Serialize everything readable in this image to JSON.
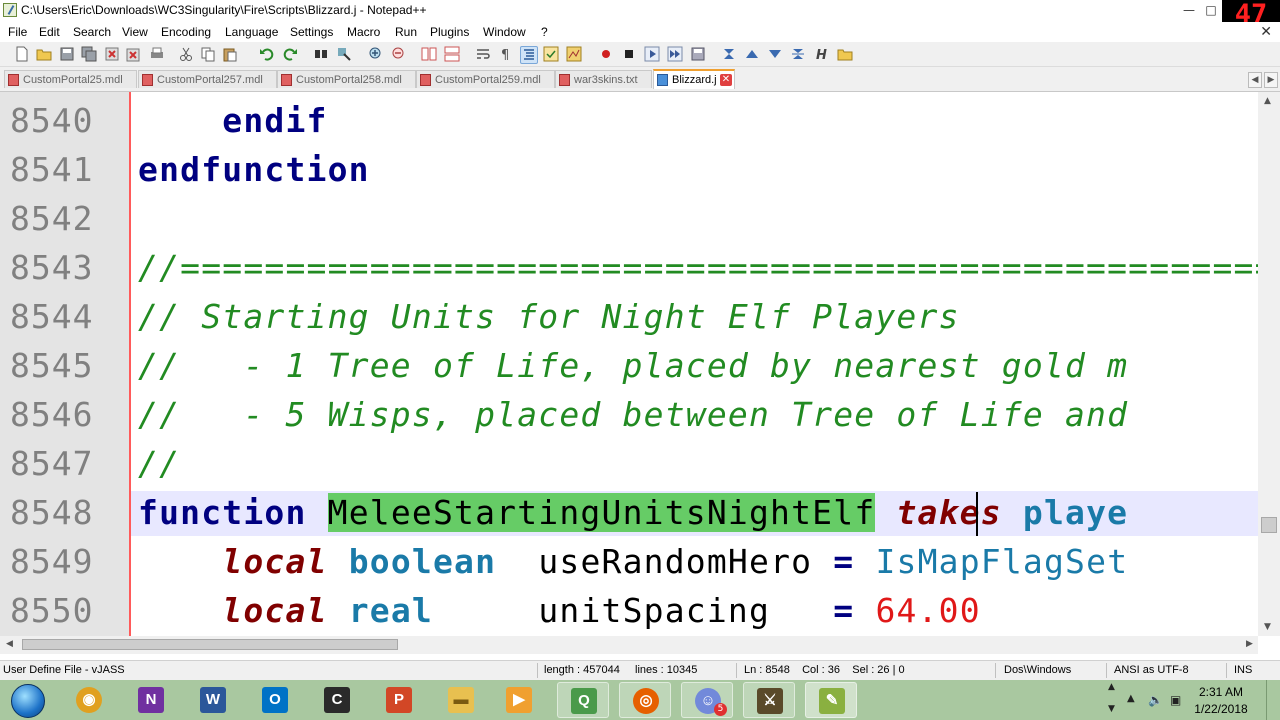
{
  "window": {
    "title": "C:\\Users\\Eric\\Downloads\\WC3Singularity\\Fire\\Scripts\\Blizzard.j - Notepad++",
    "minimize_glyph": "—",
    "maximize_glyph": "□",
    "counter_value": "47"
  },
  "menu": {
    "items": [
      "File",
      "Edit",
      "Search",
      "View",
      "Encoding",
      "Language",
      "Settings",
      "Macro",
      "Run",
      "Plugins",
      "Window",
      "?"
    ],
    "close_glyph": "✕"
  },
  "tabs": [
    {
      "label": "CustomPortal25.mdl",
      "active": false
    },
    {
      "label": "CustomPortal257.mdl",
      "active": false
    },
    {
      "label": "CustomPortal258.mdl",
      "active": false
    },
    {
      "label": "CustomPortal259.mdl",
      "active": false
    },
    {
      "label": "war3skins.txt",
      "active": false
    },
    {
      "label": "Blizzard.j",
      "active": true
    }
  ],
  "tab_close_glyph": "✕",
  "editor": {
    "line_numbers": [
      "8540",
      "8541",
      "8542",
      "8543",
      "8544",
      "8545",
      "8546",
      "8547",
      "8548",
      "8549",
      "8550"
    ],
    "line_8540": "    endif",
    "line_8541": "endfunction",
    "line_8543": "//=======================================================",
    "line_8544": "// Starting Units for Night Elf Players",
    "line_8545": "//   - 1 Tree of Life, placed by nearest gold m",
    "line_8546": "//   - 5 Wisps, placed between Tree of Life and",
    "line_8547": "//",
    "line_8548_kw": "function",
    "line_8548_name": "MeleeStartingUnitsNightElf",
    "line_8548_takes": "takes",
    "line_8548_rest": "playe",
    "line_8549_local": "local",
    "line_8549_type": "boolean",
    "line_8549_var": "useRandomHero",
    "line_8549_eq": "=",
    "line_8549_call": "IsMapFlagSet",
    "line_8550_local": "local",
    "line_8550_type": "real",
    "line_8550_var": "unitSpacing",
    "line_8550_eq": "=",
    "line_8550_num": "64.00"
  },
  "status": {
    "language": "User Define File - vJASS",
    "length": "length : 457044",
    "lines": "lines : 10345",
    "position": "Ln : 8548    Col : 36    Sel : 26 | 0",
    "eol": "Dos\\Windows",
    "encoding": "ANSI as UTF-8",
    "mode": "INS"
  },
  "taskbar": {
    "apps": [
      {
        "name": "chrome-canary",
        "glyph": "◉",
        "color": "#e0a020"
      },
      {
        "name": "onenote",
        "glyph": "N",
        "color": "#7030a0"
      },
      {
        "name": "word",
        "glyph": "W",
        "color": "#2b579a"
      },
      {
        "name": "outlook",
        "glyph": "O",
        "color": "#0072c6"
      },
      {
        "name": "terminal",
        "glyph": "C",
        "color": "#2a2a2a"
      },
      {
        "name": "powerpoint",
        "glyph": "P",
        "color": "#d24726"
      },
      {
        "name": "file-explorer",
        "glyph": "▬",
        "color": "#e8c050"
      },
      {
        "name": "media-player",
        "glyph": "▶",
        "color": "#f0a030"
      },
      {
        "name": "pdf-app",
        "glyph": "Q",
        "color": "#4a9a4a"
      },
      {
        "name": "firefox",
        "glyph": "◎",
        "color": "#e66000"
      },
      {
        "name": "discord",
        "glyph": "☺",
        "color": "#7289da"
      },
      {
        "name": "warcraft",
        "glyph": "⚔",
        "color": "#5a4a2a"
      },
      {
        "name": "notepad-plus-plus",
        "glyph": "✎",
        "color": "#8ab040"
      }
    ],
    "discord_badge": "5",
    "clock_time": "2:31 AM",
    "clock_date": "1/22/2018"
  },
  "colors": {
    "keyword": "#000080",
    "comment": "#228b22",
    "selection": "#66cc66",
    "number": "#e01818",
    "gutter_border": "#ff5a5a"
  }
}
